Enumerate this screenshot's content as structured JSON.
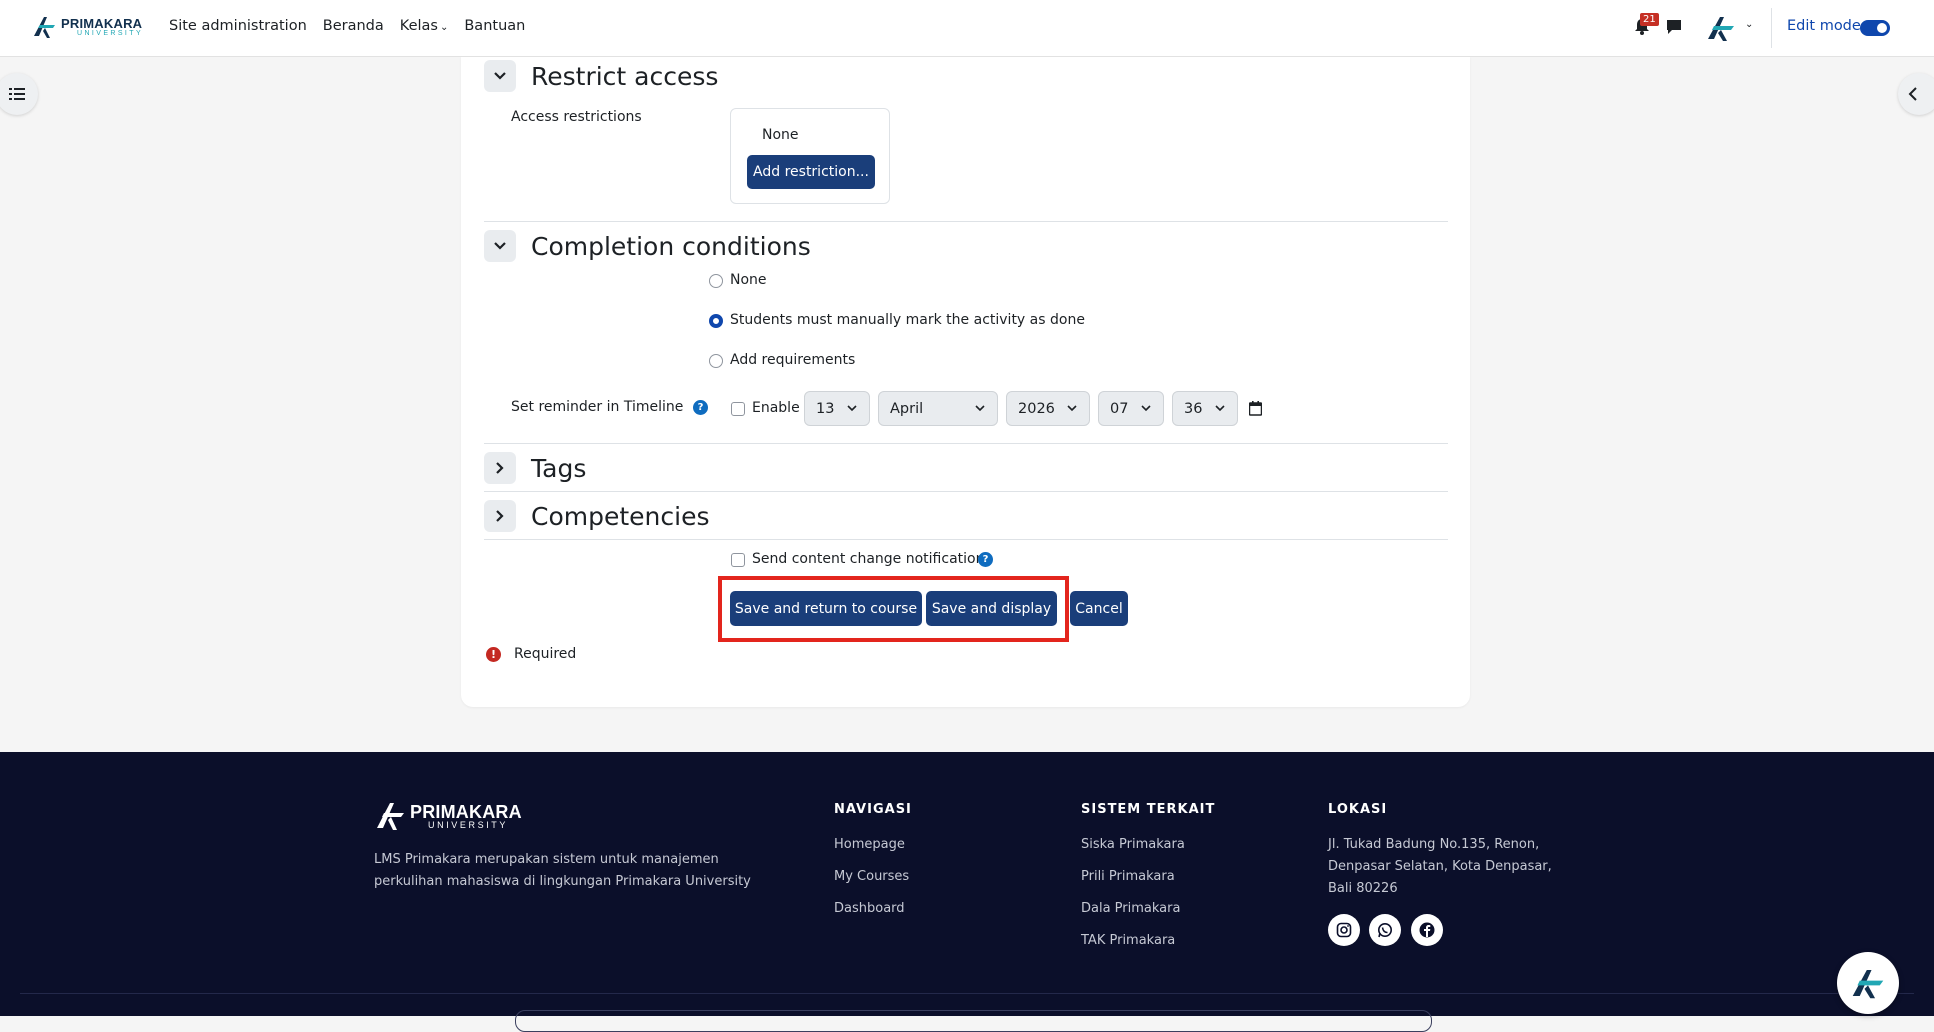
{
  "navbar": {
    "logo_main": "PRIMAKARA",
    "logo_sub": "UNIVERSITY",
    "links": [
      "Site administration",
      "Beranda",
      "Kelas",
      "Bantuan"
    ],
    "notification_count": "21",
    "edit_mode_label": "Edit mode",
    "edit_mode_on": true
  },
  "restrict_access": {
    "title": "Restrict access",
    "field_label": "Access restrictions",
    "value": "None",
    "add_button": "Add restriction..."
  },
  "completion": {
    "title": "Completion conditions",
    "options": [
      "None",
      "Students must manually mark the activity as done",
      "Add requirements"
    ],
    "selected_index": 1,
    "reminder_label": "Set reminder in Timeline",
    "enable_label": "Enable",
    "enable_checked": false,
    "day": "13",
    "month": "April",
    "year": "2026",
    "hour": "07",
    "minute": "36"
  },
  "sections": {
    "tags": "Tags",
    "competencies": "Competencies"
  },
  "form_actions": {
    "notify_label": "Send content change notification",
    "save_return": "Save and return to course",
    "save_display": "Save and display",
    "cancel": "Cancel",
    "required_label": "Required"
  },
  "footer": {
    "logo_main": "PRIMAKARA",
    "logo_sub": "UNIVERSITY",
    "description": "LMS Primakara merupakan sistem untuk manajemen perkulihan mahasiswa di lingkungan Primakara University",
    "nav_heading": "NAVIGASI",
    "nav_links": [
      "Homepage",
      "My Courses",
      "Dashboard"
    ],
    "system_heading": "SISTEM TERKAIT",
    "system_links": [
      "Siska Primakara",
      "Prili Primakara",
      "Dala Primakara",
      "TAK Primakara"
    ],
    "location_heading": "LOKASI",
    "address": "Jl. Tukad Badung No.135, Renon, Denpasar Selatan, Kota Denpasar, Bali 80226"
  },
  "colors": {
    "primary": "#1a3e7a",
    "accent": "#0f47ad",
    "footer_bg": "#0b0f2a",
    "highlight": "#e3251d"
  }
}
